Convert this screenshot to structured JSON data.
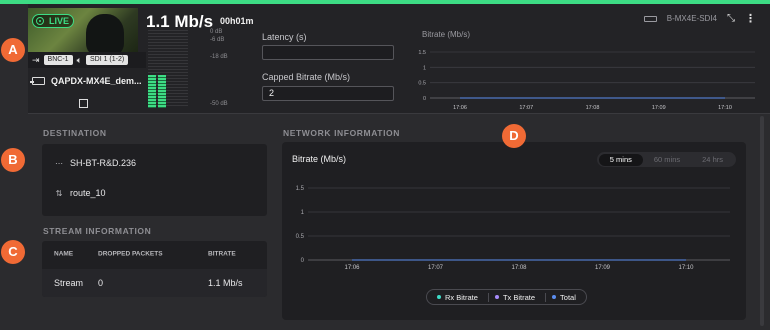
{
  "header": {
    "live_label": "LIVE",
    "bitrate": "1.1 Mb/s",
    "duration": "00h01m",
    "input_chip": "BNC-1",
    "audio_chip": "SDI 1 (1-2)",
    "device_name": "QAPDX-MX4E_dem...",
    "device_id": "B-MX4E-SDI4",
    "db_labels": [
      "0 dB",
      "-6 dB",
      "-18 dB",
      "-50 dB"
    ],
    "latency_label": "Latency (s)",
    "latency_value": "",
    "capped_label": "Capped Bitrate (Mb/s)",
    "capped_value": "2",
    "mini_chart_title": "Bitrate (Mb/s)"
  },
  "destination": {
    "title": "DESTINATION",
    "items": [
      "SH-BT-R&D.236",
      "route_10"
    ]
  },
  "stream": {
    "title": "STREAM INFORMATION",
    "columns": [
      "NAME",
      "DROPPED PACKETS",
      "BITRATE"
    ],
    "rows": [
      {
        "name": "Stream",
        "dropped": "0",
        "bitrate": "1.1 Mb/s"
      }
    ]
  },
  "network": {
    "title": "NETWORK INFORMATION",
    "chart_title": "Bitrate (Mb/s)",
    "ranges": [
      "5 mins",
      "60 mins",
      "24 hrs"
    ],
    "active_range": "5 mins",
    "legend": [
      {
        "label": "Rx Bitrate",
        "color": "#3ddcc8"
      },
      {
        "label": "Tx Bitrate",
        "color": "#a78bfa"
      },
      {
        "label": "Total",
        "color": "#5b8def"
      }
    ]
  },
  "markers": [
    "A",
    "B",
    "C",
    "D"
  ],
  "chart_data": [
    {
      "type": "line",
      "ylabel": "Bitrate (Mb/s)",
      "x": [
        "17:06",
        "17:07",
        "17:08",
        "17:09",
        "17:10"
      ],
      "y_ticks": [
        "1.5",
        "1",
        "0.5",
        "0"
      ],
      "ylim": [
        0,
        1.5
      ],
      "series": [
        {
          "values": [
            0,
            0,
            0,
            0,
            0
          ]
        }
      ]
    },
    {
      "type": "line",
      "title": "Bitrate (Mb/s)",
      "x": [
        "17:06",
        "17:07",
        "17:08",
        "17:09",
        "17:10"
      ],
      "y_ticks": [
        "1.5",
        "1",
        "0.5",
        "0"
      ],
      "ylim": [
        0,
        1.5
      ],
      "series": [
        {
          "name": "Rx Bitrate",
          "values": [
            0,
            0,
            0,
            0,
            0
          ]
        },
        {
          "name": "Tx Bitrate",
          "values": [
            0,
            0,
            0,
            0,
            0
          ]
        },
        {
          "name": "Total",
          "values": [
            0,
            0,
            0,
            0,
            0
          ]
        }
      ]
    }
  ],
  "meter_levels": [
    0.42,
    0.42
  ]
}
